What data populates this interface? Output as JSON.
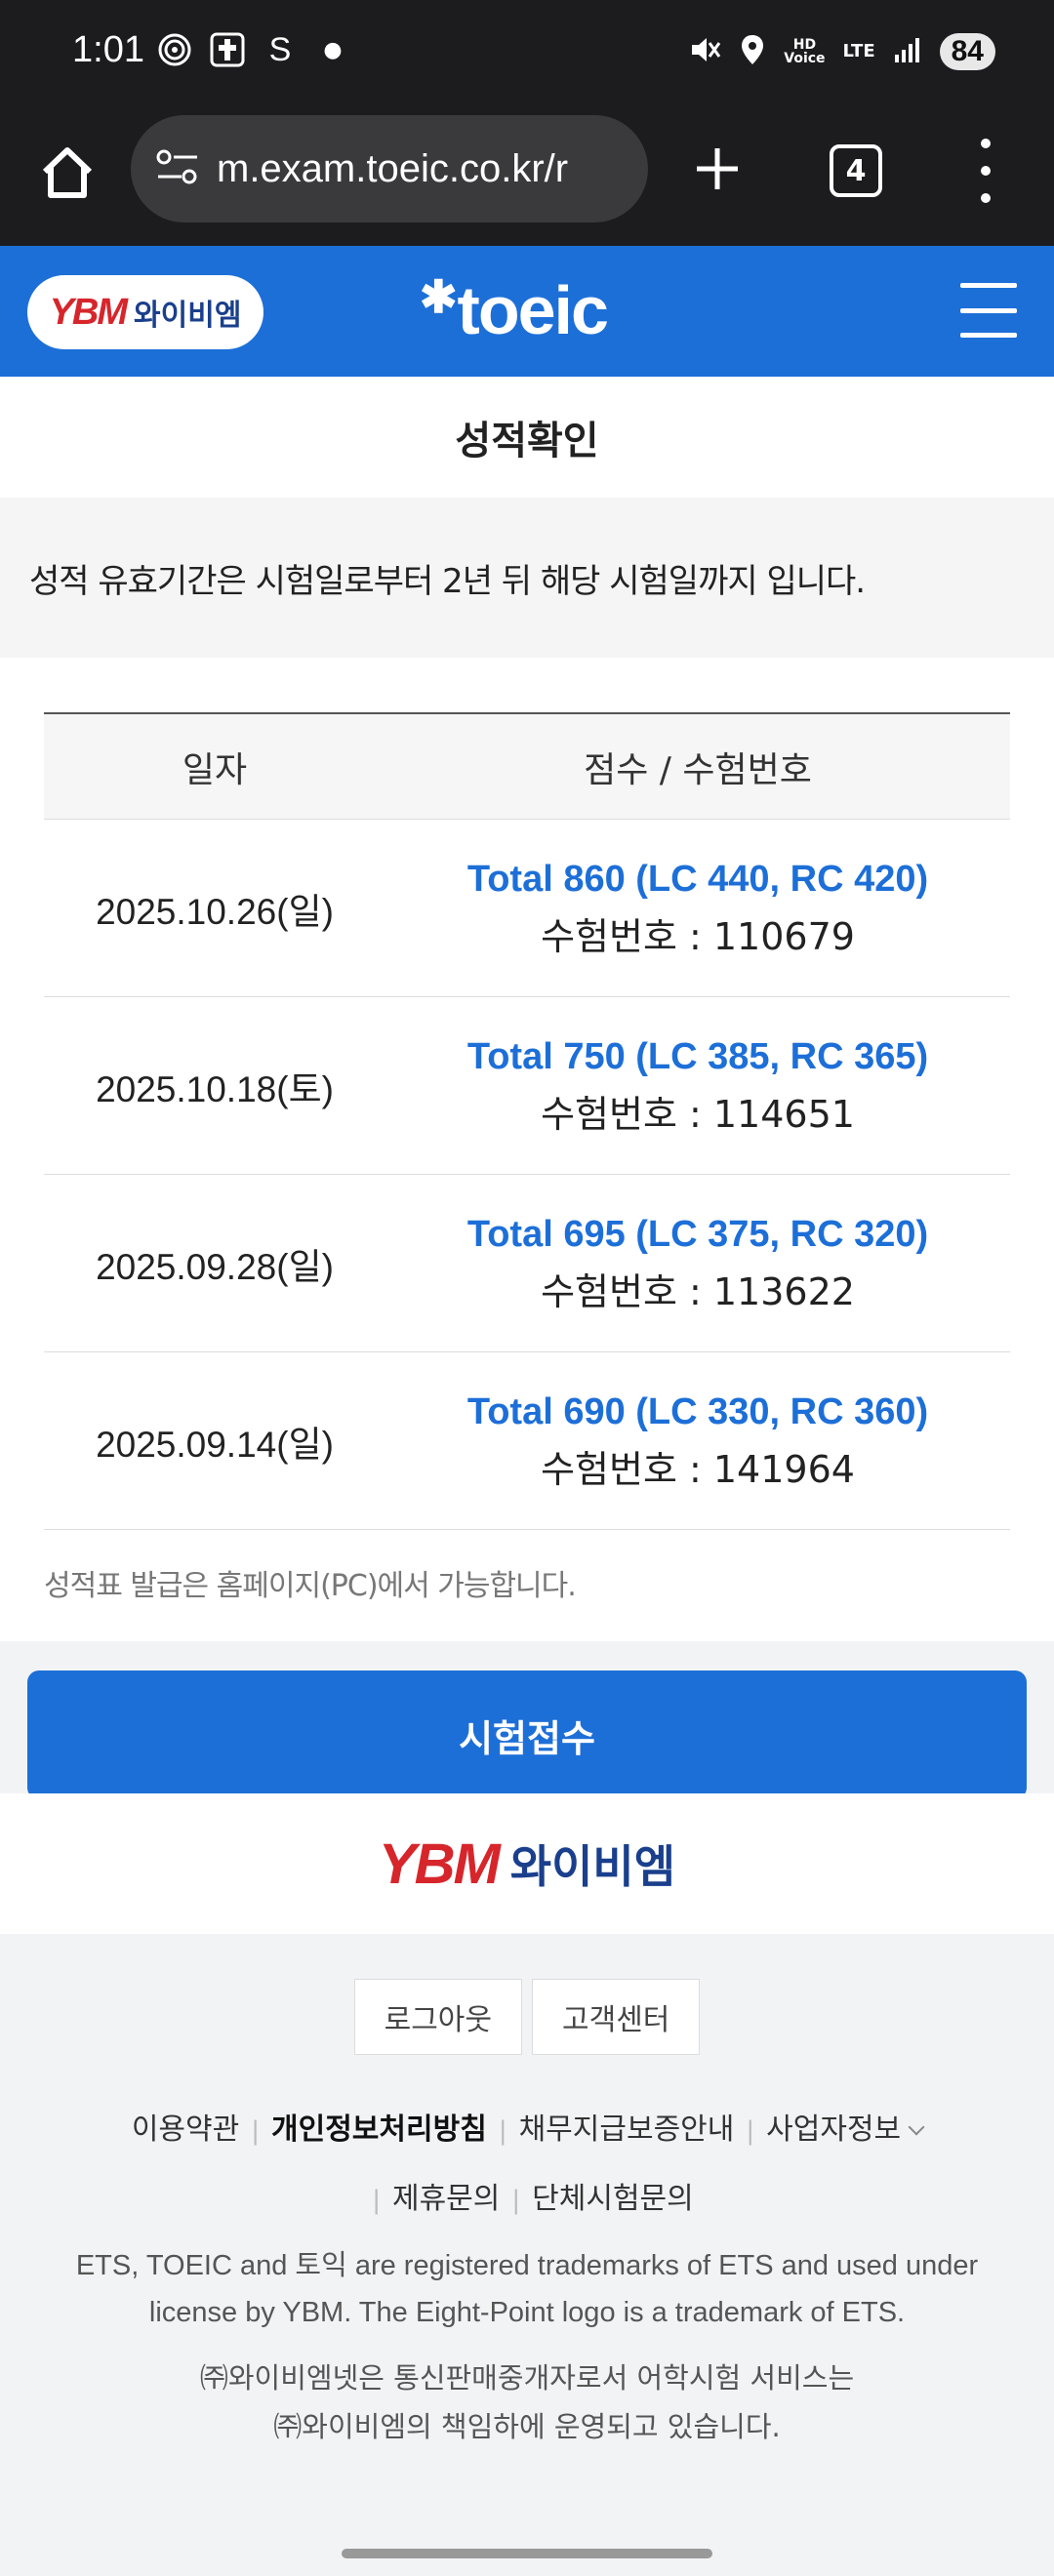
{
  "status_bar": {
    "time": "1:01",
    "carrier_glyph": "S",
    "network": "LTE",
    "battery": "84"
  },
  "browser": {
    "url": "m.exam.toeic.co.kr/r",
    "tab_count": "4"
  },
  "site_header": {
    "ybm_mark": "YBM",
    "ybm_name": "와이비엠",
    "toeic_logo": "toeic"
  },
  "page": {
    "title": "성적확인",
    "notice": "성적 유효기간은 시험일로부터 2년 뒤 해당 시험일까지 입니다."
  },
  "table": {
    "headers": [
      "일자",
      "점수 / 수험번호"
    ],
    "rows": [
      {
        "date": "2025.10.26(일)",
        "total": "Total 860 (LC 440, RC 420)",
        "exam_no": "수험번호 : 110679"
      },
      {
        "date": "2025.10.18(토)",
        "total": "Total 750 (LC 385, RC 365)",
        "exam_no": "수험번호 : 114651"
      },
      {
        "date": "2025.09.28(일)",
        "total": "Total 695 (LC 375, RC 320)",
        "exam_no": "수험번호 : 113622"
      },
      {
        "date": "2025.09.14(일)",
        "total": "Total 690 (LC 330, RC 360)",
        "exam_no": "수험번호 : 141964"
      }
    ]
  },
  "issue_note": "성적표 발급은 홈페이지(PC)에서 가능합니다.",
  "apply_button": "시험접수",
  "footer": {
    "logo_mark": "YBM",
    "logo_name": "와이비엠",
    "logout": "로그아웃",
    "customer_center": "고객센터",
    "links": [
      "이용약관",
      "개인정보처리방침",
      "채무지급보증안내",
      "사업자정보",
      "제휴문의",
      "단체시험문의"
    ],
    "legal_line1": "ETS, TOEIC and 토익 are registered trademarks of ETS and used under",
    "legal_line2": "license by YBM. The Eight-Point logo is a trademark of ETS.",
    "legal_line3": "㈜와이비엠넷은 통신판매중개자로서 어학시험 서비스는",
    "legal_line4": "㈜와이비엠의 책임하에 운영되고 있습니다."
  },
  "colors": {
    "brand_blue": "#1d6fd8",
    "ybm_red": "#d6262b",
    "dark_bar": "#1c1c1e"
  }
}
